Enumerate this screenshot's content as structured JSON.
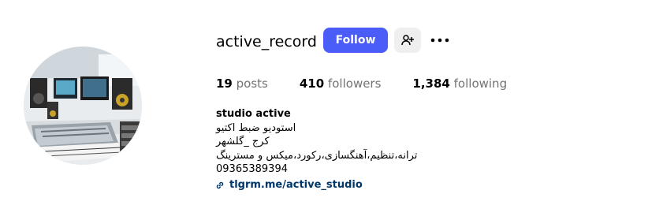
{
  "profile": {
    "username": "active_record",
    "follow_label": "Follow",
    "stats": {
      "posts_count": "19",
      "posts_label": "posts",
      "followers_count": "410",
      "followers_label": "followers",
      "following_count": "1,384",
      "following_label": "following"
    },
    "bio": {
      "name": "studio active",
      "lines": [
        "استودیو ضبط اکتیو",
        "کرج _گلشهر",
        "ترانه،تنظیم،آهنگسازی،رکورد،میکس و مسترینگ",
        "09365389394"
      ],
      "link": "tlgrm.me/active_studio"
    }
  },
  "icons": {
    "suggest": "person-add-icon",
    "more": "more-options-icon",
    "link": "link-icon"
  },
  "colors": {
    "follow_button": "#4a5df9",
    "secondary_button": "#efefef",
    "link": "#00376b",
    "muted_text": "#737373"
  }
}
